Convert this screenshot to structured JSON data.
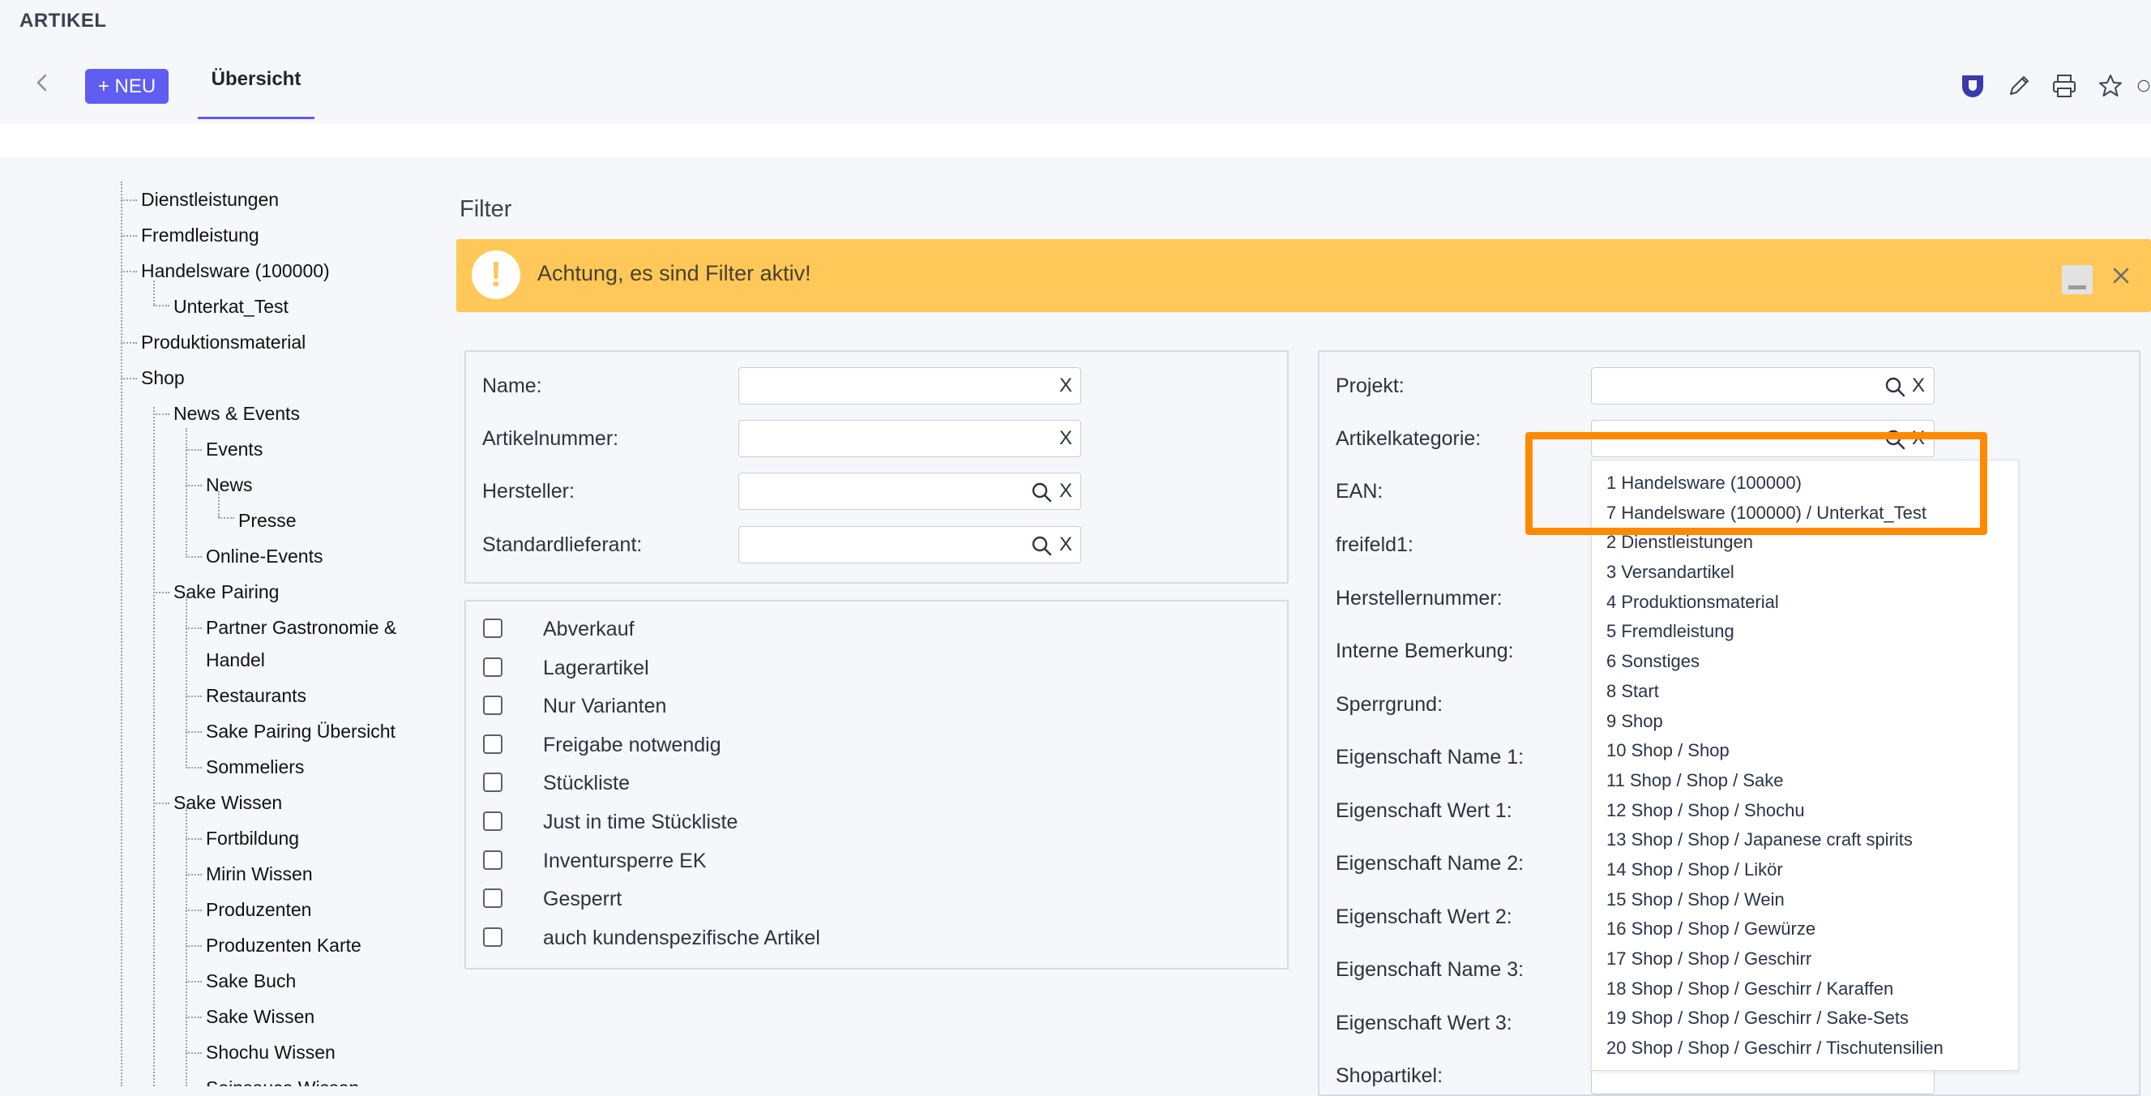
{
  "header": {
    "app_title": "ARTIKEL",
    "new_button": "+ NEU",
    "tab_overview": "Übersicht"
  },
  "tree": {
    "items": [
      {
        "label": "Dienstleistungen",
        "level": 0
      },
      {
        "label": "Fremdleistung",
        "level": 0
      },
      {
        "label": "Handelsware (100000)",
        "level": 0
      },
      {
        "label": "Unterkat_Test",
        "level": 1
      },
      {
        "label": "Produktionsmaterial",
        "level": 0
      },
      {
        "label": "Shop",
        "level": 0
      },
      {
        "label": "News & Events",
        "level": 1
      },
      {
        "label": "Events",
        "level": 2
      },
      {
        "label": "News",
        "level": 2
      },
      {
        "label": "Presse",
        "level": 3
      },
      {
        "label": "Online-Events",
        "level": 2
      },
      {
        "label": "Sake Pairing",
        "level": 1
      },
      {
        "label": "Partner Gastronomie &",
        "level": 2
      },
      {
        "label": "Handel",
        "level": 2
      },
      {
        "label": "Restaurants",
        "level": 2
      },
      {
        "label": "Sake Pairing Übersicht",
        "level": 2
      },
      {
        "label": "Sommeliers",
        "level": 2
      },
      {
        "label": "Sake Wissen",
        "level": 1
      },
      {
        "label": "Fortbildung",
        "level": 2
      },
      {
        "label": "Mirin Wissen",
        "level": 2
      },
      {
        "label": "Produzenten",
        "level": 2
      },
      {
        "label": "Produzenten Karte",
        "level": 2
      },
      {
        "label": "Sake Buch",
        "level": 2
      },
      {
        "label": "Sake Wissen",
        "level": 2
      },
      {
        "label": "Shochu Wissen",
        "level": 2
      },
      {
        "label": "Seinsauce Wissen",
        "level": 2
      }
    ]
  },
  "filter": {
    "heading": "Filter",
    "alert_text": "Achtung, es sind Filter aktiv!",
    "alert_icon": "!",
    "clear_glyph": "X",
    "left_fields": [
      "Name:",
      "Artikelnummer:",
      "Hersteller:",
      "Standardlieferant:"
    ],
    "checkboxes": [
      "Abverkauf",
      "Lagerartikel",
      "Nur Varianten",
      "Freigabe notwendig",
      "Stückliste",
      "Just in time Stückliste",
      "Inventursperre EK",
      "Gesperrt",
      "auch kundenspezifische Artikel"
    ],
    "right_fields": [
      "Projekt:",
      "Artikelkategorie:",
      "EAN:",
      "freifeld1:",
      "Herstellernummer:",
      "Interne Bemerkung:",
      "Sperrgrund:",
      "Eigenschaft Name 1:",
      "Eigenschaft Wert 1:",
      "Eigenschaft Name 2:",
      "Eigenschaft Wert 2:",
      "Eigenschaft Name 3:",
      "Eigenschaft Wert 3:",
      "Shopartikel:"
    ]
  },
  "category_dropdown": {
    "options": [
      "1 Handelsware (100000)",
      "7 Handelsware (100000) / Unterkat_Test",
      "2 Dienstleistungen",
      "3 Versandartikel",
      "4 Produktionsmaterial",
      "5 Fremdleistung",
      "6 Sonstiges",
      "8 Start",
      "9 Shop",
      "10 Shop / Shop",
      "11 Shop / Shop / Sake",
      "12 Shop / Shop / Shochu",
      "13 Shop / Shop / Japanese craft spirits",
      "14 Shop / Shop / Likör",
      "15 Shop / Shop / Wein",
      "16 Shop / Shop / Gewürze",
      "17 Shop / Shop / Geschirr",
      "18 Shop / Shop / Geschirr / Karaffen",
      "19 Shop / Shop / Geschirr / Sake-Sets",
      "20 Shop / Shop / Geschirr / Tischutensilien"
    ]
  },
  "colors": {
    "accent": "#5f5df2",
    "alert_bg": "#ffc859",
    "highlight": "#ff8a00"
  }
}
